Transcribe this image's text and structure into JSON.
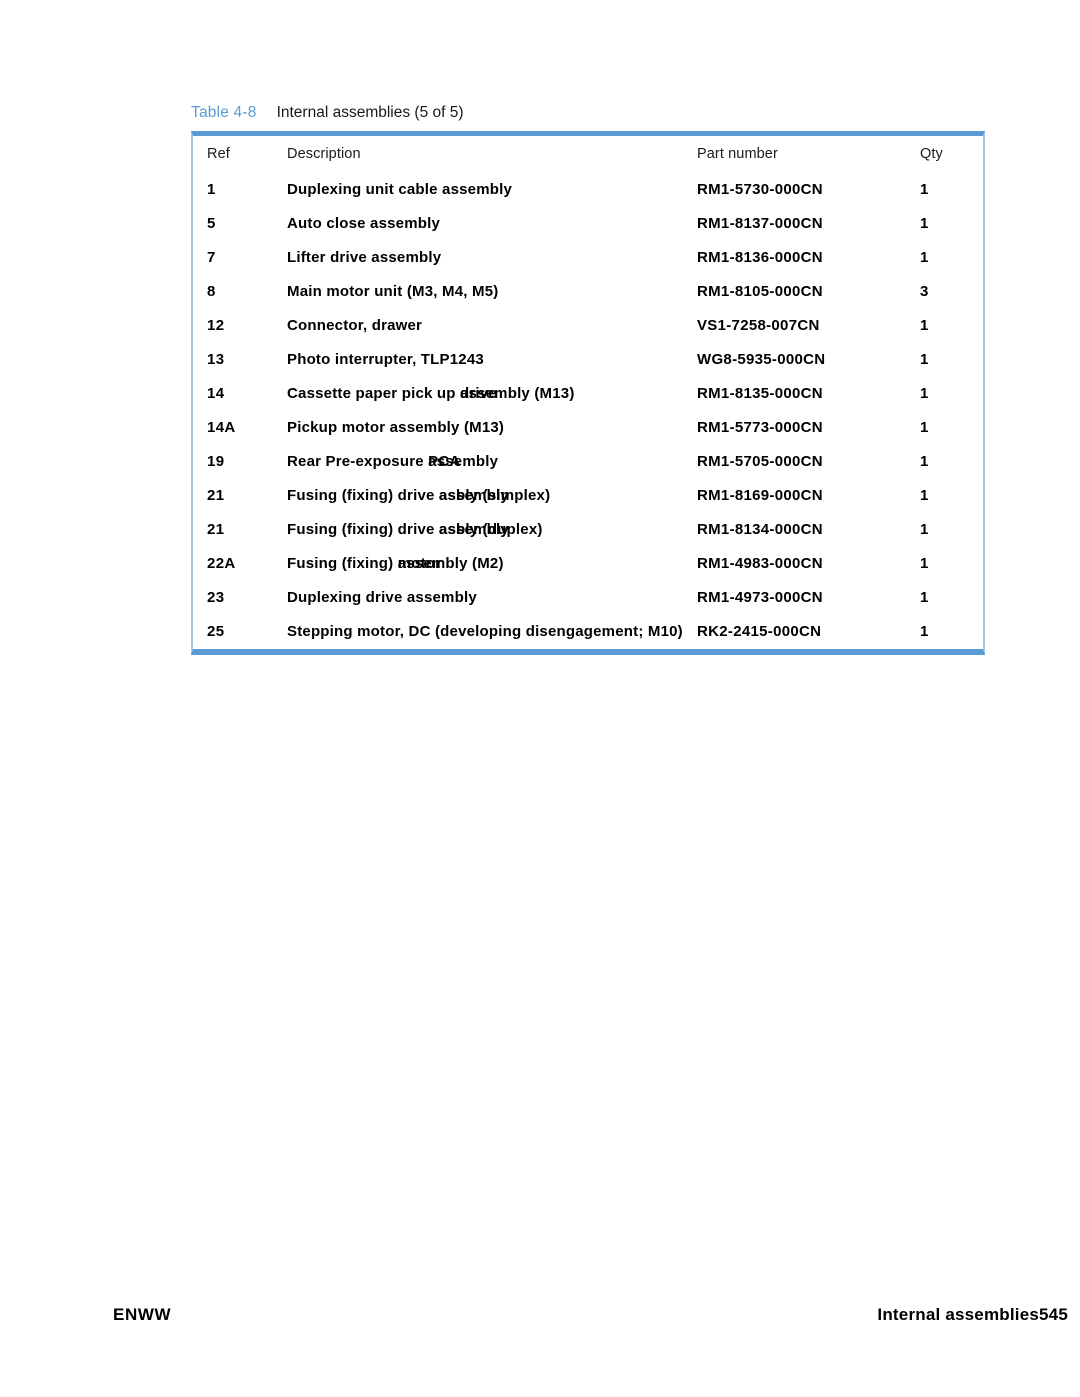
{
  "caption": {
    "label": "Table 4-8",
    "text": "Internal assemblies (5 of 5)"
  },
  "colors": {
    "accent_blue": "#5b9bd5",
    "caption_blue": "#5a9bd5",
    "side_border": "#a8c8e8",
    "text": "#000000"
  },
  "table": {
    "headers": {
      "ref": "Ref",
      "description": "Description",
      "part_number": "Part number",
      "qty": "Qty"
    },
    "rows": [
      {
        "ref": "1",
        "description": "Duplexing unit cable assembly",
        "desc_overlap": null,
        "part_number": "RM1-5730-000CN",
        "qty": "1"
      },
      {
        "ref": "5",
        "description": "Auto close assembly",
        "desc_overlap": null,
        "part_number": "RM1-8137-000CN",
        "qty": "1"
      },
      {
        "ref": "7",
        "description": "Lifter drive assembly",
        "desc_overlap": null,
        "part_number": "RM1-8136-000CN",
        "qty": "1"
      },
      {
        "ref": "8",
        "description": "Main motor unit (M3, M4, M5)",
        "desc_overlap": null,
        "part_number": "RM1-8105-000CN",
        "qty": "3"
      },
      {
        "ref": "12",
        "description": "Connector, drawer",
        "desc_overlap": null,
        "part_number": "VS1-7258-007CN",
        "qty": "1"
      },
      {
        "ref": "13",
        "description": "Photo interrupter, TLP1243",
        "desc_overlap": null,
        "part_number": "WG8-5935-000CN",
        "qty": "1"
      },
      {
        "ref": "14",
        "description": "Cassette paper pick up drive assembly (M13)",
        "desc_overlap": {
          "prefix": "Cassette paper pick up ",
          "layer_a": "drive",
          "layer_b": "assembly",
          "suffix": " (M13)"
        },
        "part_number": "RM1-8135-000CN",
        "qty": "1"
      },
      {
        "ref": "14A",
        "description": "Pickup motor assembly (M13)",
        "desc_overlap": null,
        "part_number": "RM1-5773-000CN",
        "qty": "1"
      },
      {
        "ref": "19",
        "description": "Rear Pre-exposure PCA assembly",
        "desc_overlap": {
          "prefix": "Rear Pre-exposure ",
          "layer_a": "PCA",
          "layer_b": "assembly",
          "suffix": ""
        },
        "part_number": "RM1-5705-000CN",
        "qty": "1"
      },
      {
        "ref": "21",
        "description": "Fusing (fixing) drive assembly (simplex)",
        "desc_overlap": {
          "prefix": "Fusing (fixing) drive ",
          "layer_a": "assembly",
          "layer_b": "asbly",
          "suffix": " (simplex)"
        },
        "part_number": "RM1-8169-000CN",
        "qty": "1"
      },
      {
        "ref": "21",
        "description": "Fusing (fixing) drive assembly (duplex)",
        "desc_overlap": {
          "prefix": "Fusing (fixing) drive ",
          "layer_a": "assembly",
          "layer_b": "asbly",
          "suffix": " (duplex)"
        },
        "part_number": "RM1-8134-000CN",
        "qty": "1"
      },
      {
        "ref": "22A",
        "description": "Fusing (fixing) motor assembly (M2)",
        "desc_overlap": {
          "prefix": "Fusing (fixing) ",
          "layer_a": "motor",
          "layer_b": "assembly",
          "suffix": " (M2)"
        },
        "part_number": "RM1-4983-000CN",
        "qty": "1"
      },
      {
        "ref": "23",
        "description": "Duplexing drive assembly",
        "desc_overlap": null,
        "part_number": "RM1-4973-000CN",
        "qty": "1"
      },
      {
        "ref": "25",
        "description": "Stepping motor, DC (developing disengagement; M10)",
        "desc_overlap": null,
        "part_number": "RK2-2415-000CN",
        "qty": "1"
      }
    ]
  },
  "footer": {
    "left": "ENWW",
    "right_text": "Internal assemblies",
    "page_number": "545"
  }
}
